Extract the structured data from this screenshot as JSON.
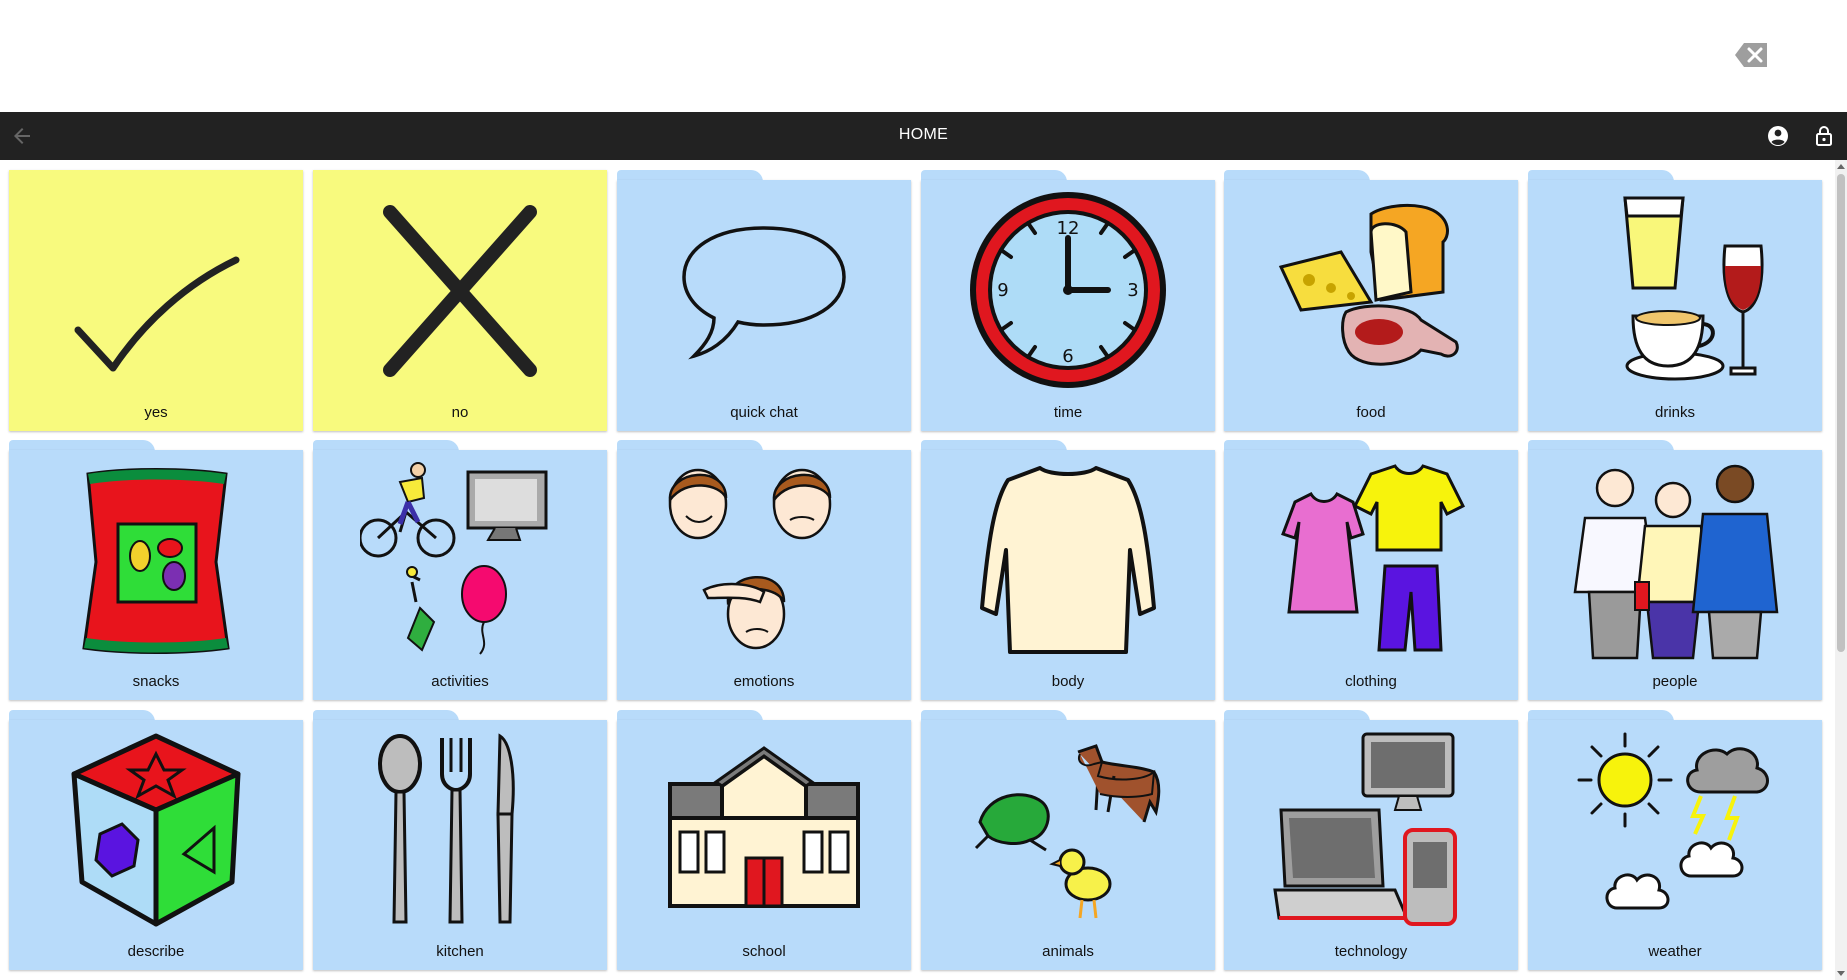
{
  "navbar": {
    "title": "HOME"
  },
  "icons": {
    "backspace": "backspace-icon",
    "back": "arrow-left-icon",
    "user": "account-circle-icon",
    "lock": "lock-icon"
  },
  "colors": {
    "navbar": "#222222",
    "button_tile": "#f8fa7e",
    "folder_tile": "#b8dbfa"
  },
  "tiles": [
    {
      "label": "yes",
      "kind": "button"
    },
    {
      "label": "no",
      "kind": "button"
    },
    {
      "label": "quick chat",
      "kind": "folder"
    },
    {
      "label": "time",
      "kind": "folder"
    },
    {
      "label": "food",
      "kind": "folder"
    },
    {
      "label": "drinks",
      "kind": "folder"
    },
    {
      "label": "snacks",
      "kind": "folder"
    },
    {
      "label": "activities",
      "kind": "folder"
    },
    {
      "label": "emotions",
      "kind": "folder"
    },
    {
      "label": "body",
      "kind": "folder"
    },
    {
      "label": "clothing",
      "kind": "folder"
    },
    {
      "label": "people",
      "kind": "folder"
    },
    {
      "label": "describe",
      "kind": "folder"
    },
    {
      "label": "kitchen",
      "kind": "folder"
    },
    {
      "label": "school",
      "kind": "folder"
    },
    {
      "label": "animals",
      "kind": "folder"
    },
    {
      "label": "technology",
      "kind": "folder"
    },
    {
      "label": "weather",
      "kind": "folder"
    }
  ]
}
